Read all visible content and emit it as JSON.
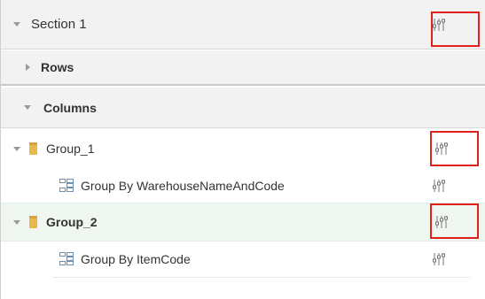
{
  "section": {
    "label": "Section 1"
  },
  "rows": {
    "label": "Rows"
  },
  "columns": {
    "label": "Columns"
  },
  "groups": [
    {
      "label": "Group_1",
      "child": "Group By WarehouseNameAndCode"
    },
    {
      "label": "Group_2",
      "child": "Group By ItemCode"
    }
  ],
  "icons": {
    "settings": "sliders-icon",
    "folder": "folder-icon",
    "group_by": "group-by-icon"
  },
  "colors": {
    "highlight": "#e0201b",
    "folder": "#e9b84a",
    "selected_row": "#f0f7f0"
  }
}
